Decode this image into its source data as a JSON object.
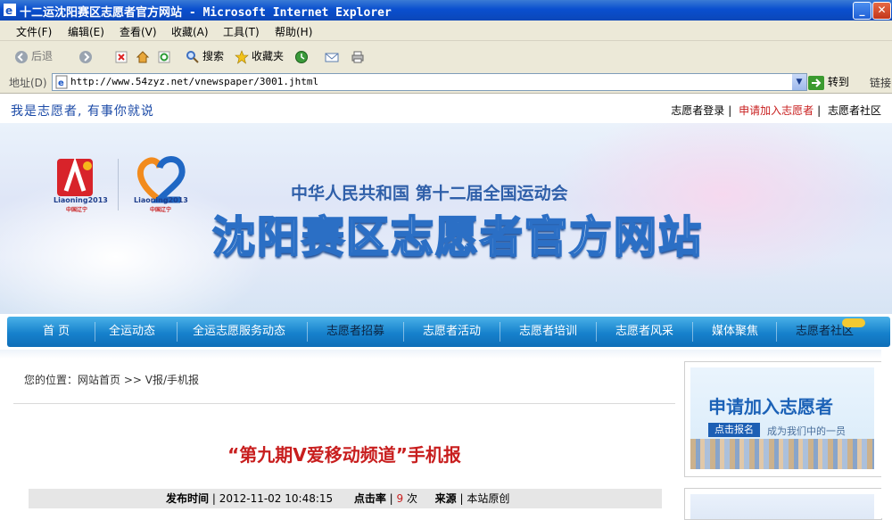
{
  "window": {
    "title": "十二运沈阳赛区志愿者官方网站 - Microsoft Internet Explorer",
    "min": "_",
    "max": "□",
    "close": "✕"
  },
  "menu": [
    "文件(F)",
    "编辑(E)",
    "查看(V)",
    "收藏(A)",
    "工具(T)",
    "帮助(H)"
  ],
  "toolbar": {
    "back": "后退",
    "search": "搜索",
    "favorites": "收藏夹"
  },
  "address": {
    "label": "地址(D)",
    "url": "http://www.54zyz.net/vnewspaper/3001.jhtml",
    "go": "转到",
    "links": "链接"
  },
  "site": {
    "slogan": "我是志愿者, 有事你就说",
    "top_links": [
      "志愿者登录",
      "申请加入志愿者",
      "志愿者社区"
    ],
    "logo1_caption": "Liaoning2013",
    "logo2_caption": "Liaoning2013",
    "logo_sub": "中国辽宁",
    "subtitle": "中华人民共和国 第十二届全国运动会",
    "title": "沈阳赛区志愿者官方网站",
    "nav": [
      "首 页",
      "全运动态",
      "全运志愿服务动态",
      "志愿者招募",
      "志愿者活动",
      "志愿者培训",
      "志愿者风采",
      "媒体聚焦",
      "志愿者社区"
    ]
  },
  "breadcrumb": "您的位置：网站首页 >> V报/手机报",
  "article": {
    "title": "“第九期V爱移动频道”手机报",
    "publish_label": "发布时间",
    "publish_time": "2012-11-02 10:48:15",
    "clicks_label": "点击率",
    "clicks": "9",
    "clicks_unit": "次",
    "source_label": "来源",
    "source": "本站原创"
  },
  "sidebar": {
    "join_title": "申请加入志愿者",
    "join_button": "点击报名",
    "join_sub": "成为我们中的一员"
  },
  "colors": {
    "titlebar": "#0a4fcf",
    "nav": "#1681cc",
    "article_title": "#c81e1e",
    "slogan": "#1b4aa7"
  }
}
